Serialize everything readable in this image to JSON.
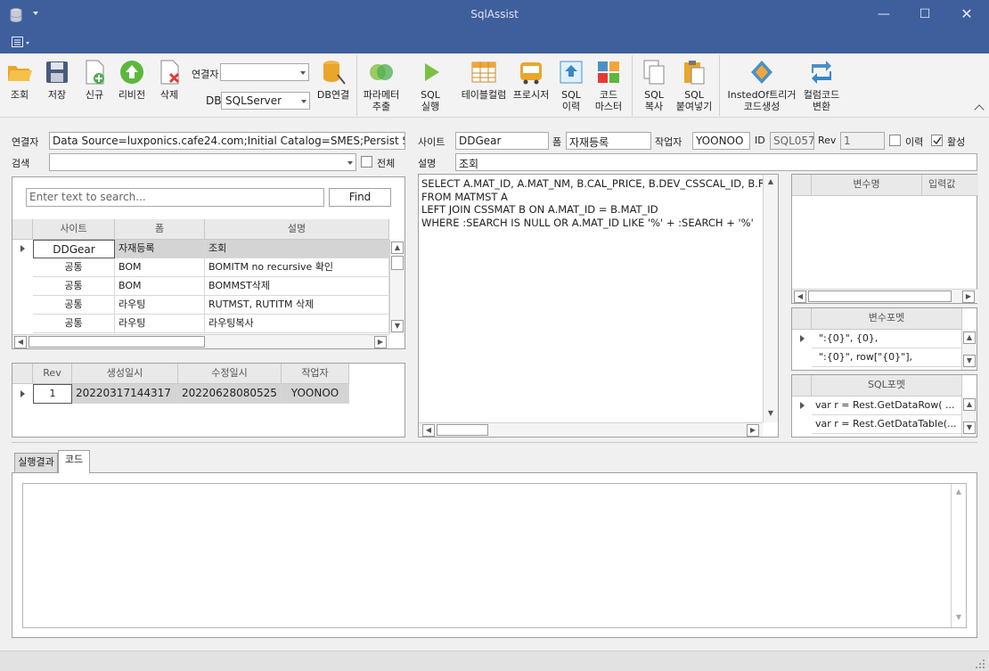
{
  "window": {
    "title": "SqlAssist"
  },
  "toolbar": {
    "buttons": [
      {
        "label": "조회"
      },
      {
        "label": "저장"
      },
      {
        "label": "신규"
      },
      {
        "label": "리비전"
      },
      {
        "label": "삭제"
      },
      {
        "label": "DB연결"
      },
      {
        "label": "파라메터\n추출"
      },
      {
        "label": "SQL\n실행"
      },
      {
        "label": "테이블컬럼"
      },
      {
        "label": "프로시저"
      },
      {
        "label": "SQL\n이력"
      },
      {
        "label": "코드\n마스터"
      },
      {
        "label": "SQL\n복사"
      },
      {
        "label": "SQL\n붙여넣기"
      },
      {
        "label": "InstedOf트리거\n코드생성"
      },
      {
        "label": "컬럼코드\n변환"
      }
    ],
    "connector_label": "연결자",
    "connector_value": "",
    "db_label": "DB",
    "db_value": "SQLServer"
  },
  "form": {
    "connector_label": "연결자",
    "connector_value": "Data Source=luxponics.cafe24.com;Initial Catalog=SMES;Persist Security",
    "search_label": "검색",
    "search_value": "",
    "all_label": "전체",
    "site_label": "사이트",
    "site_value": "DDGear",
    "form_label": "폼",
    "form_value": "자재등록",
    "author_label": "작업자",
    "author_value": "YOONOO",
    "id_label": "ID",
    "id_value": "SQL057",
    "rev_label": "Rev",
    "rev_value": "1",
    "history_label": "이력",
    "history_checked": false,
    "active_label": "활성",
    "active_checked": true,
    "desc_label": "설명",
    "desc_value": "조회"
  },
  "search_panel": {
    "placeholder": "Enter text to search...",
    "find_label": "Find"
  },
  "sql_list": {
    "columns": [
      "사이트",
      "폼",
      "설명"
    ],
    "rows": [
      {
        "site": "DDGear",
        "form": "자재등록",
        "desc": "조회"
      },
      {
        "site": "공통",
        "form": "BOM",
        "desc": "BOMITM no recursive 확인"
      },
      {
        "site": "공통",
        "form": "BOM",
        "desc": "BOMMST삭제"
      },
      {
        "site": "공통",
        "form": "라우팅",
        "desc": "RUTMST, RUTITM 삭제"
      },
      {
        "site": "공통",
        "form": "라우팅",
        "desc": "라우팅복사"
      }
    ]
  },
  "rev_grid": {
    "columns": [
      "Rev",
      "생성일시",
      "수정일시",
      "작업자"
    ],
    "rows": [
      {
        "rev": "1",
        "created": "20220317144317",
        "modified": "20220628080525",
        "author": "YOONOO"
      }
    ]
  },
  "sql_editor": {
    "lines": [
      "SELECT A.MAT_ID, A.MAT_NM, B.CAL_PRICE, B.DEV_CSSCAL_ID, B.F",
      "FROM MATMST A",
      "LEFT JOIN CSSMAT B ON A.MAT_ID = B.MAT_ID",
      "WHERE :SEARCH IS NULL OR A.MAT_ID LIKE '%' + :SEARCH + '%'"
    ]
  },
  "var_grid": {
    "columns": [
      "변수명",
      "입력값"
    ]
  },
  "var_format": {
    "title": "변수포멧",
    "rows": [
      "\":{0}\", {0},",
      "\":{0}\", row[\"{0}\"],"
    ]
  },
  "sql_format": {
    "title": "SQL포멧",
    "rows": [
      "var r = Rest.GetDataRow( ...",
      "var r = Rest.GetDataTable(..."
    ]
  },
  "bottom_tabs": [
    {
      "label": "실행결과"
    },
    {
      "label": "코드"
    }
  ]
}
